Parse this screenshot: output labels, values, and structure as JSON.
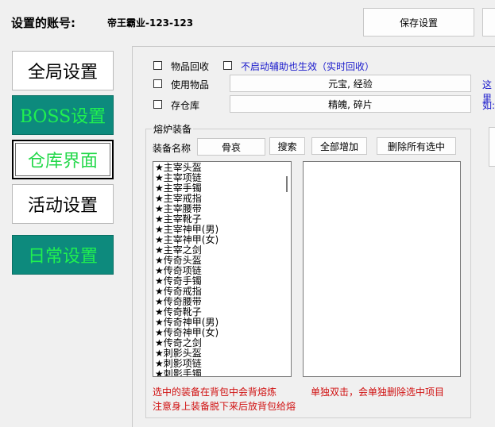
{
  "header": {
    "account_label": "设置的账号:",
    "account_value": "帝王霸业-123-123",
    "save_button": "保存设置"
  },
  "nav": {
    "global": "全局设置",
    "boss": "BOSS设置",
    "warehouse": "仓库界面",
    "activity": "活动设置",
    "daily": "日常设置"
  },
  "options": {
    "item_recycle": "物品回收",
    "no_assist_effect": "不启动辅助也生效（实时回收）",
    "use_items": "使用物品",
    "use_items_value": "元宝, 经验",
    "store_warehouse": "存仓库",
    "store_warehouse_value": "精魄, 碎片",
    "right_note_1": "这里",
    "right_note_2": "如:"
  },
  "furnace": {
    "group_title": "熔炉装备",
    "name_label": "装备名称",
    "name_value": "骨哀",
    "search_button": "搜索",
    "add_all_button": "全部增加",
    "delete_selected_button": "删除所有选中",
    "items": [
      "★主宰头盔",
      "★主宰项链",
      "★主宰手镯",
      "★主宰戒指",
      "★主宰腰带",
      "★主宰靴子",
      "★主宰神甲(男)",
      "★主宰神甲(女)",
      "★主宰之剑",
      "★传奇头盔",
      "★传奇项链",
      "★传奇手镯",
      "★传奇戒指",
      "★传奇腰带",
      "★传奇靴子",
      "★传奇神甲(男)",
      "★传奇神甲(女)",
      "★传奇之剑",
      "★刺影头盔",
      "★刺影项链",
      "★刺影手镯"
    ],
    "note_left_1": "选中的装备在背包中会背熔炼",
    "note_left_2": "注意身上装备脱下来后放背包给熔",
    "note_right": "单独双击，会单独删除选中项目"
  }
}
